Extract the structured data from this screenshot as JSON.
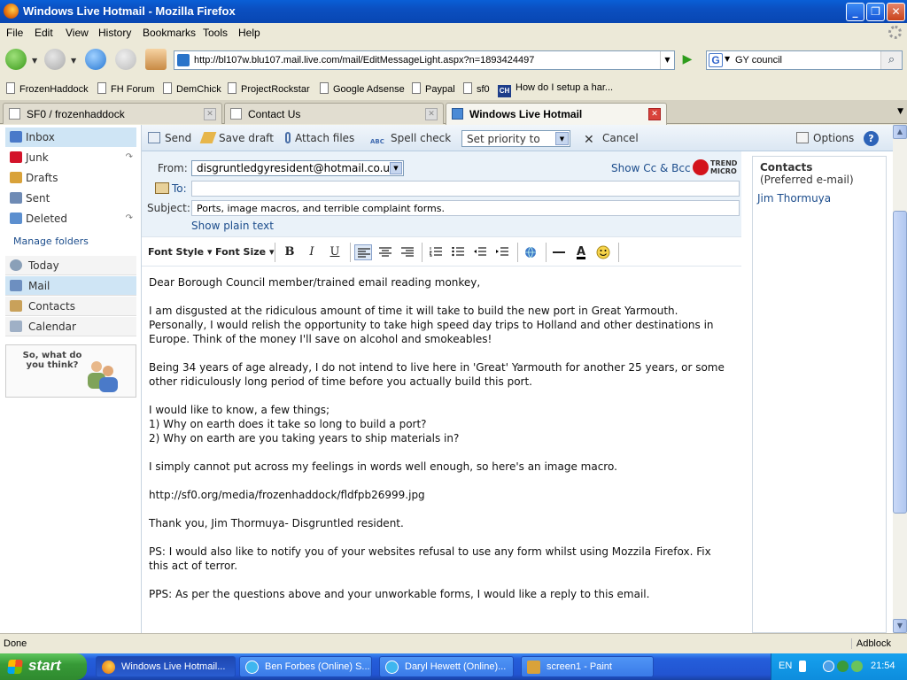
{
  "window": {
    "title": "Windows Live Hotmail - Mozilla Firefox"
  },
  "menu": [
    "File",
    "Edit",
    "View",
    "History",
    "Bookmarks",
    "Tools",
    "Help"
  ],
  "address": {
    "url": "http://bl107w.blu107.mail.live.com/mail/EditMessageLight.aspx?n=1893424497"
  },
  "search": {
    "query": "GY council"
  },
  "bookmarks": [
    "FrozenHaddock",
    "FH Forum",
    "DemChick",
    "ProjectRockstar",
    "Google Adsense",
    "Paypal",
    "sf0",
    "How do I setup a har..."
  ],
  "bookmark_badge": "CH",
  "tabs": [
    {
      "label": "SF0 / frozenhaddock"
    },
    {
      "label": "Contact Us"
    },
    {
      "label": "Windows Live Hotmail"
    }
  ],
  "folders": [
    {
      "label": "Inbox",
      "color": "#4a7ac9"
    },
    {
      "label": "Junk",
      "color": "#d3132a"
    },
    {
      "label": "Drafts",
      "color": "#d9a23a"
    },
    {
      "label": "Sent",
      "color": "#6f8bb5"
    },
    {
      "label": "Deleted",
      "color": "#5c8fcf"
    }
  ],
  "manage_folders": "Manage folders",
  "nav_groups": [
    "Today",
    "Mail",
    "Contacts",
    "Calendar"
  ],
  "help_box": {
    "question": "So, what do you think?"
  },
  "toolbar": {
    "send": "Send",
    "save_draft": "Save draft",
    "attach": "Attach files",
    "spell": "Spell check",
    "abc": "ABC",
    "priority": "Set priority to",
    "cancel": "Cancel",
    "options": "Options",
    "help": "?"
  },
  "headers": {
    "from_label": "From:",
    "from_value": "disgruntledgyresident@hotmail.co.uk",
    "show_cc": "Show Cc & Bcc",
    "to_label": "To:",
    "subject_label": "Subject:",
    "subject_value": "Ports, image macros, and terrible complaint forms.",
    "plain_text": "Show plain text",
    "brand_line1": "TREND",
    "brand_line2": "MICRO"
  },
  "format": {
    "font_style": "Font Style",
    "font_size": "Font Size",
    "bold": "B",
    "italic": "I",
    "underline": "U"
  },
  "message": {
    "p1": "Dear Borough Council member/trained email reading monkey,",
    "p2": "I am disgusted at the ridiculous amount of time it will take to build the new port in Great Yarmouth. Personally, I would relish the opportunity to take high speed day trips to Holland and other destinations in Europe. Think of the money I'll save on alcohol and smokeables!",
    "p3": "Being 34 years of age already, I do not intend to live here in 'Great' Yarmouth for another 25 years, or some other ridiculously long period of time before you actually build this port.",
    "p4": "I would like to know, a few things;\n1) Why on earth does it take so long to build a port?\n2) Why on earth are you taking years to ship materials in?",
    "p5": "I simply cannot put across my feelings in words well enough, so here's an image macro.",
    "p6": "http://sf0.org/media/frozenhaddock/fldfpb26999.jpg",
    "p7": "Thank you, Jim Thormuya- Disgruntled resident.",
    "p8": "PS: I would also like to notify you of your websites refusal to use any form whilst using Mozzila Firefox. Fix this act of terror.",
    "p9": "PPS: As per the questions above and your unworkable forms, I would like a reply to this email."
  },
  "contacts": {
    "heading": "Contacts",
    "sub": "(Preferred e-mail)",
    "name": "Jim Thormuya"
  },
  "status": {
    "text": "Done",
    "adblock": "Adblock"
  },
  "taskbar": {
    "start": "start",
    "tasks": [
      "Windows Live Hotmail...",
      "Ben Forbes (Online) S...",
      "Daryl Hewett (Online)...",
      "screen1 - Paint"
    ],
    "lang": "EN",
    "clock": "21:54"
  },
  "colors": {
    "title_blue": "#0b4fc0",
    "link_blue": "#1c4d8c",
    "selected_folder": "#cfe5f5",
    "header_bg": "#eaf2f9"
  }
}
